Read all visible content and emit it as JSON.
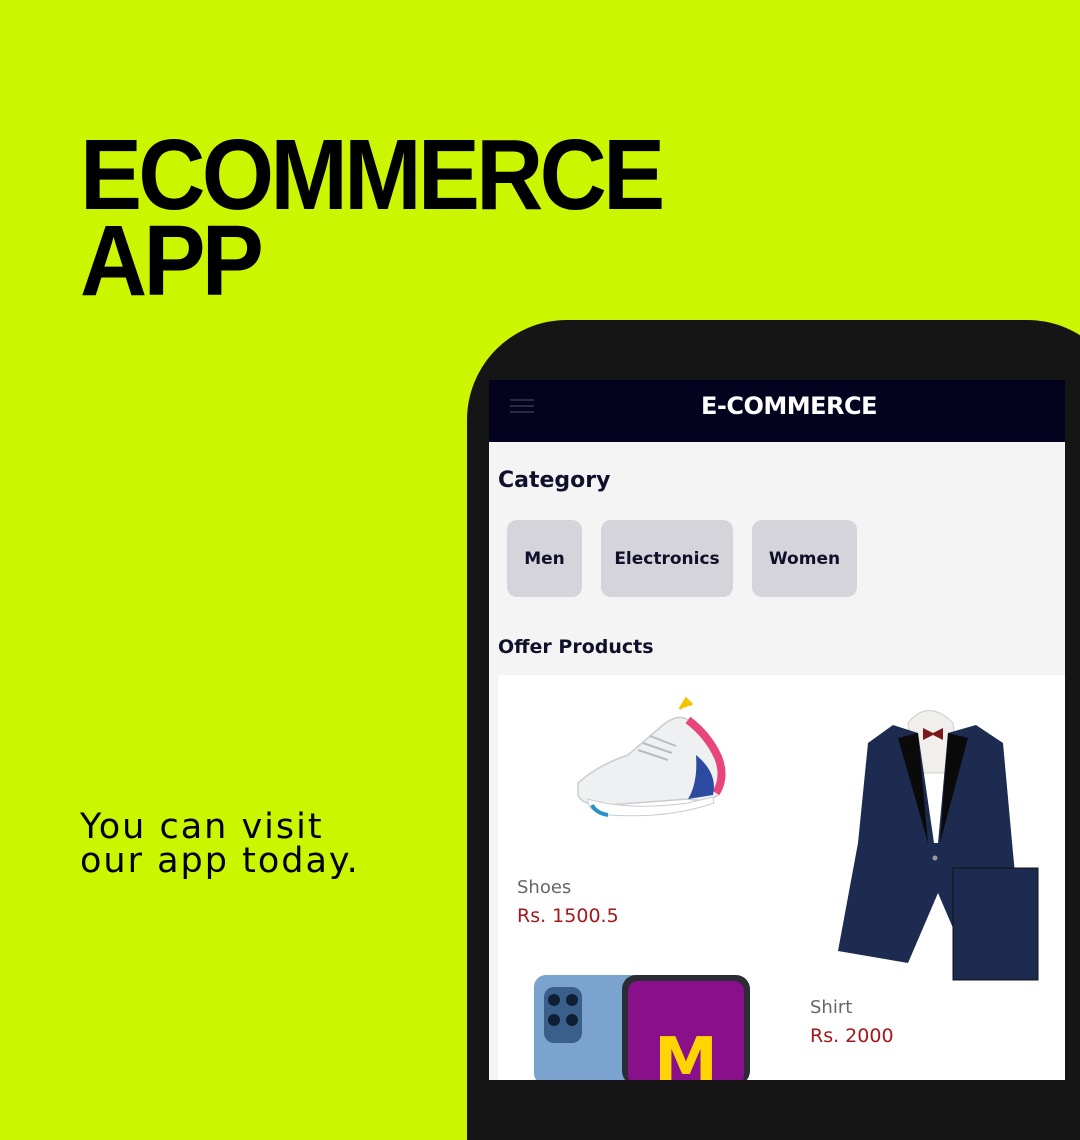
{
  "headline": {
    "line1": "ECOMMERCE",
    "line2": "APP"
  },
  "tagline": {
    "line1": "You can visit",
    "line2": "our app today."
  },
  "app": {
    "title": "E-COMMERCE",
    "category_heading": "Category",
    "categories": [
      "Men",
      "Electronics",
      "Women"
    ],
    "offer_heading": "Offer Products",
    "products": [
      {
        "name": "Shoes",
        "price": "Rs. 1500.5"
      },
      {
        "name": "Shirt",
        "price": "Rs. 2000"
      }
    ],
    "phone_logo_letter": "M"
  },
  "colors": {
    "background": "#ccf500",
    "appbar": "#030320",
    "price": "#a3171e",
    "chip": "#d5d4da"
  }
}
